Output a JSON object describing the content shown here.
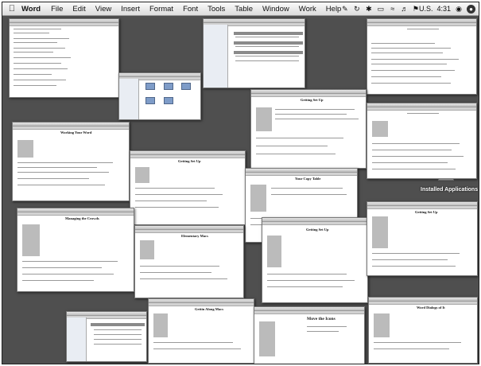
{
  "menubar": {
    "apple_icon": "apple-icon",
    "app_name": "Word",
    "menus": [
      "File",
      "Edit",
      "View",
      "Insert",
      "Format",
      "Font",
      "Tools",
      "Table",
      "Window",
      "Work",
      "Help"
    ],
    "status": {
      "input_menu": "U.S.",
      "clock": "4:31"
    }
  },
  "desktop": {
    "icon_label": "Installed Applications"
  },
  "windows": {
    "titles": [
      "Getting Set Up",
      "Working Your Word",
      "Getting Set Up",
      "Your Copy Table",
      "Managing the Crowds",
      "Elementary Macs",
      "Gettin Along Macs",
      "Move the Icons",
      "Word Dialogs of It"
    ]
  }
}
